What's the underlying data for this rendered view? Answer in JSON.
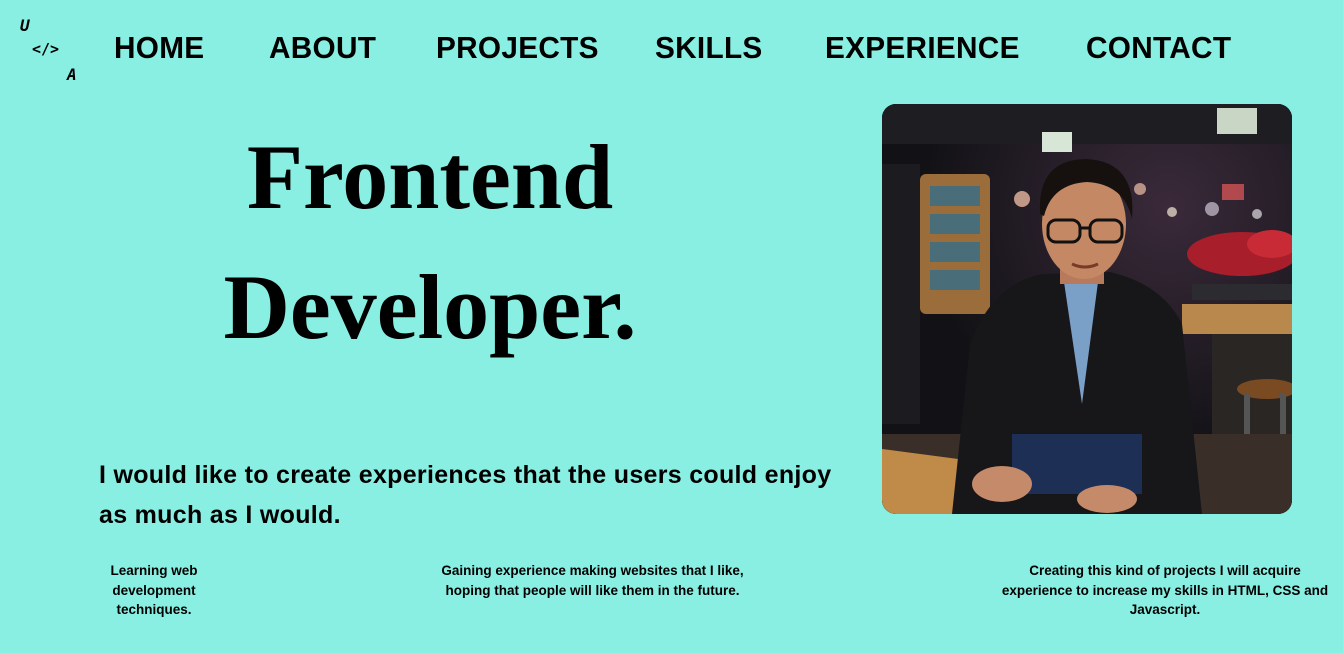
{
  "logo": {
    "line1": "U",
    "line2": "</>",
    "line3": "A"
  },
  "nav": {
    "items": [
      {
        "label": "HOME"
      },
      {
        "label": "ABOUT"
      },
      {
        "label": "PROJECTS"
      },
      {
        "label": "SKILLS"
      },
      {
        "label": "EXPERIENCE"
      },
      {
        "label": "CONTACT"
      }
    ]
  },
  "hero": {
    "title_line1": "Frontend",
    "title_line2": "Developer.",
    "tagline": "I would like to create experiences that the users could enjoy as much as I would."
  },
  "info": [
    {
      "text": "Learning web development techniques."
    },
    {
      "text": "Gaining experience making websites that I like, hoping that people will like them in the future."
    },
    {
      "text": "Creating this kind of projects I will acquire experience to increase my skills in HTML, CSS and Javascript."
    }
  ],
  "colors": {
    "background": "#88efe2",
    "text": "#000000"
  },
  "icons": {
    "profile_photo": "profile-photo"
  }
}
